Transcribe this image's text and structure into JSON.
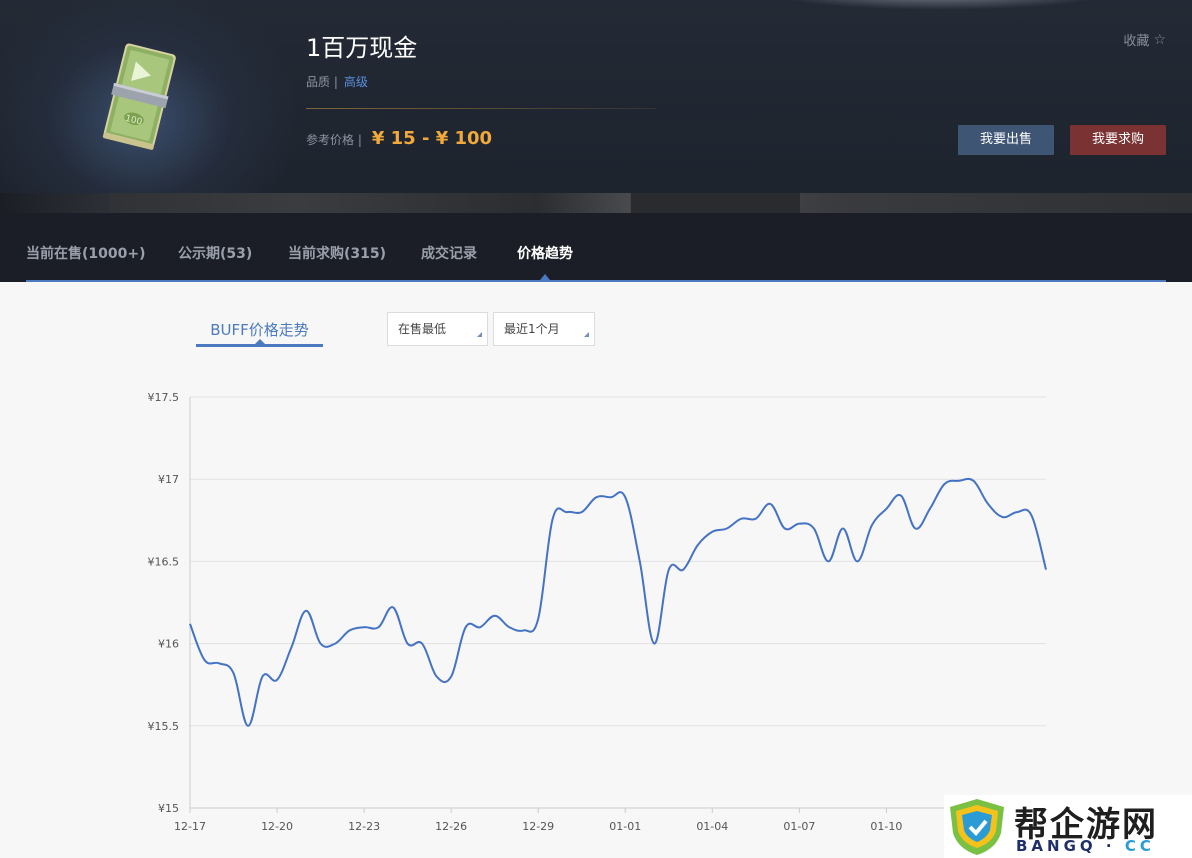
{
  "header": {
    "item_title": "1百万现金",
    "quality_label": "品质 |",
    "quality_value": "高级",
    "ref_price_label": "参考价格 |",
    "ref_price_value": "¥ 15 - ¥ 100",
    "favorite_label": "收藏",
    "favorite_icon": "star-outline-icon",
    "sell_button": "我要出售",
    "buy_button": "我要求购"
  },
  "tabs": [
    {
      "label": "当前在售(1000+)",
      "active": false
    },
    {
      "label": "公示期(53)",
      "active": false
    },
    {
      "label": "当前求购(315)",
      "active": false
    },
    {
      "label": "成交记录",
      "active": false
    },
    {
      "label": "价格趋势",
      "active": true
    }
  ],
  "chart_controls": {
    "chart_tab": "BUFF价格走势",
    "price_type_select": "在售最低",
    "time_range_select": "最近1个月"
  },
  "colors": {
    "accent": "#4c7ac0",
    "price": "#f2a93b",
    "sell_button": "#3e5573",
    "buy_button": "#7a3232"
  },
  "chart_data": {
    "type": "line",
    "title": "",
    "xlabel": "",
    "ylabel": "",
    "ylim": [
      15,
      17.5
    ],
    "y_ticks": [
      "¥15",
      "¥15.5",
      "¥16",
      "¥16.5",
      "¥17",
      "¥17.5"
    ],
    "y_tick_values": [
      15,
      15.5,
      16,
      16.5,
      17,
      17.5
    ],
    "x_ticks": [
      "12-17",
      "12-20",
      "12-23",
      "12-26",
      "12-29",
      "01-01",
      "01-04",
      "01-07",
      "01-10"
    ],
    "x_tick_days": [
      0,
      3,
      6,
      9,
      12,
      15,
      18,
      21,
      24
    ],
    "series": [
      {
        "name": "",
        "color": "#4472c4",
        "x_days": [
          0,
          0.5,
          1,
          1.5,
          2,
          2.5,
          3,
          3.5,
          4,
          4.5,
          5,
          5.5,
          6,
          6.5,
          7,
          7.5,
          8,
          8.5,
          9,
          9.5,
          10,
          10.5,
          11,
          11.5,
          12,
          12.5,
          13,
          13.5,
          14,
          14.5,
          15,
          15.5,
          16,
          16.5,
          17,
          17.5,
          18,
          18.5,
          19,
          19.5,
          20,
          20.5,
          21,
          21.5,
          22,
          22.5,
          23,
          23.5,
          24,
          24.5,
          25,
          25.5,
          26,
          26.5,
          27,
          27.5,
          28,
          28.5,
          29,
          29.5
        ],
        "values": [
          16.12,
          15.9,
          15.88,
          15.82,
          15.5,
          15.8,
          15.78,
          15.98,
          16.2,
          16.0,
          16.0,
          16.08,
          16.1,
          16.1,
          16.22,
          16.0,
          16.0,
          15.8,
          15.8,
          16.1,
          16.1,
          16.17,
          16.1,
          16.08,
          16.15,
          16.76,
          16.8,
          16.8,
          16.89,
          16.89,
          16.89,
          16.5,
          16.0,
          16.45,
          16.45,
          16.6,
          16.68,
          16.7,
          16.76,
          16.76,
          16.85,
          16.7,
          16.73,
          16.7,
          16.5,
          16.7,
          16.5,
          16.72,
          16.82,
          16.9,
          16.7,
          16.82,
          16.97,
          16.99,
          16.99,
          16.85,
          16.77,
          16.8,
          16.78,
          16.45
        ]
      }
    ],
    "grid": true,
    "legend": "none"
  }
}
